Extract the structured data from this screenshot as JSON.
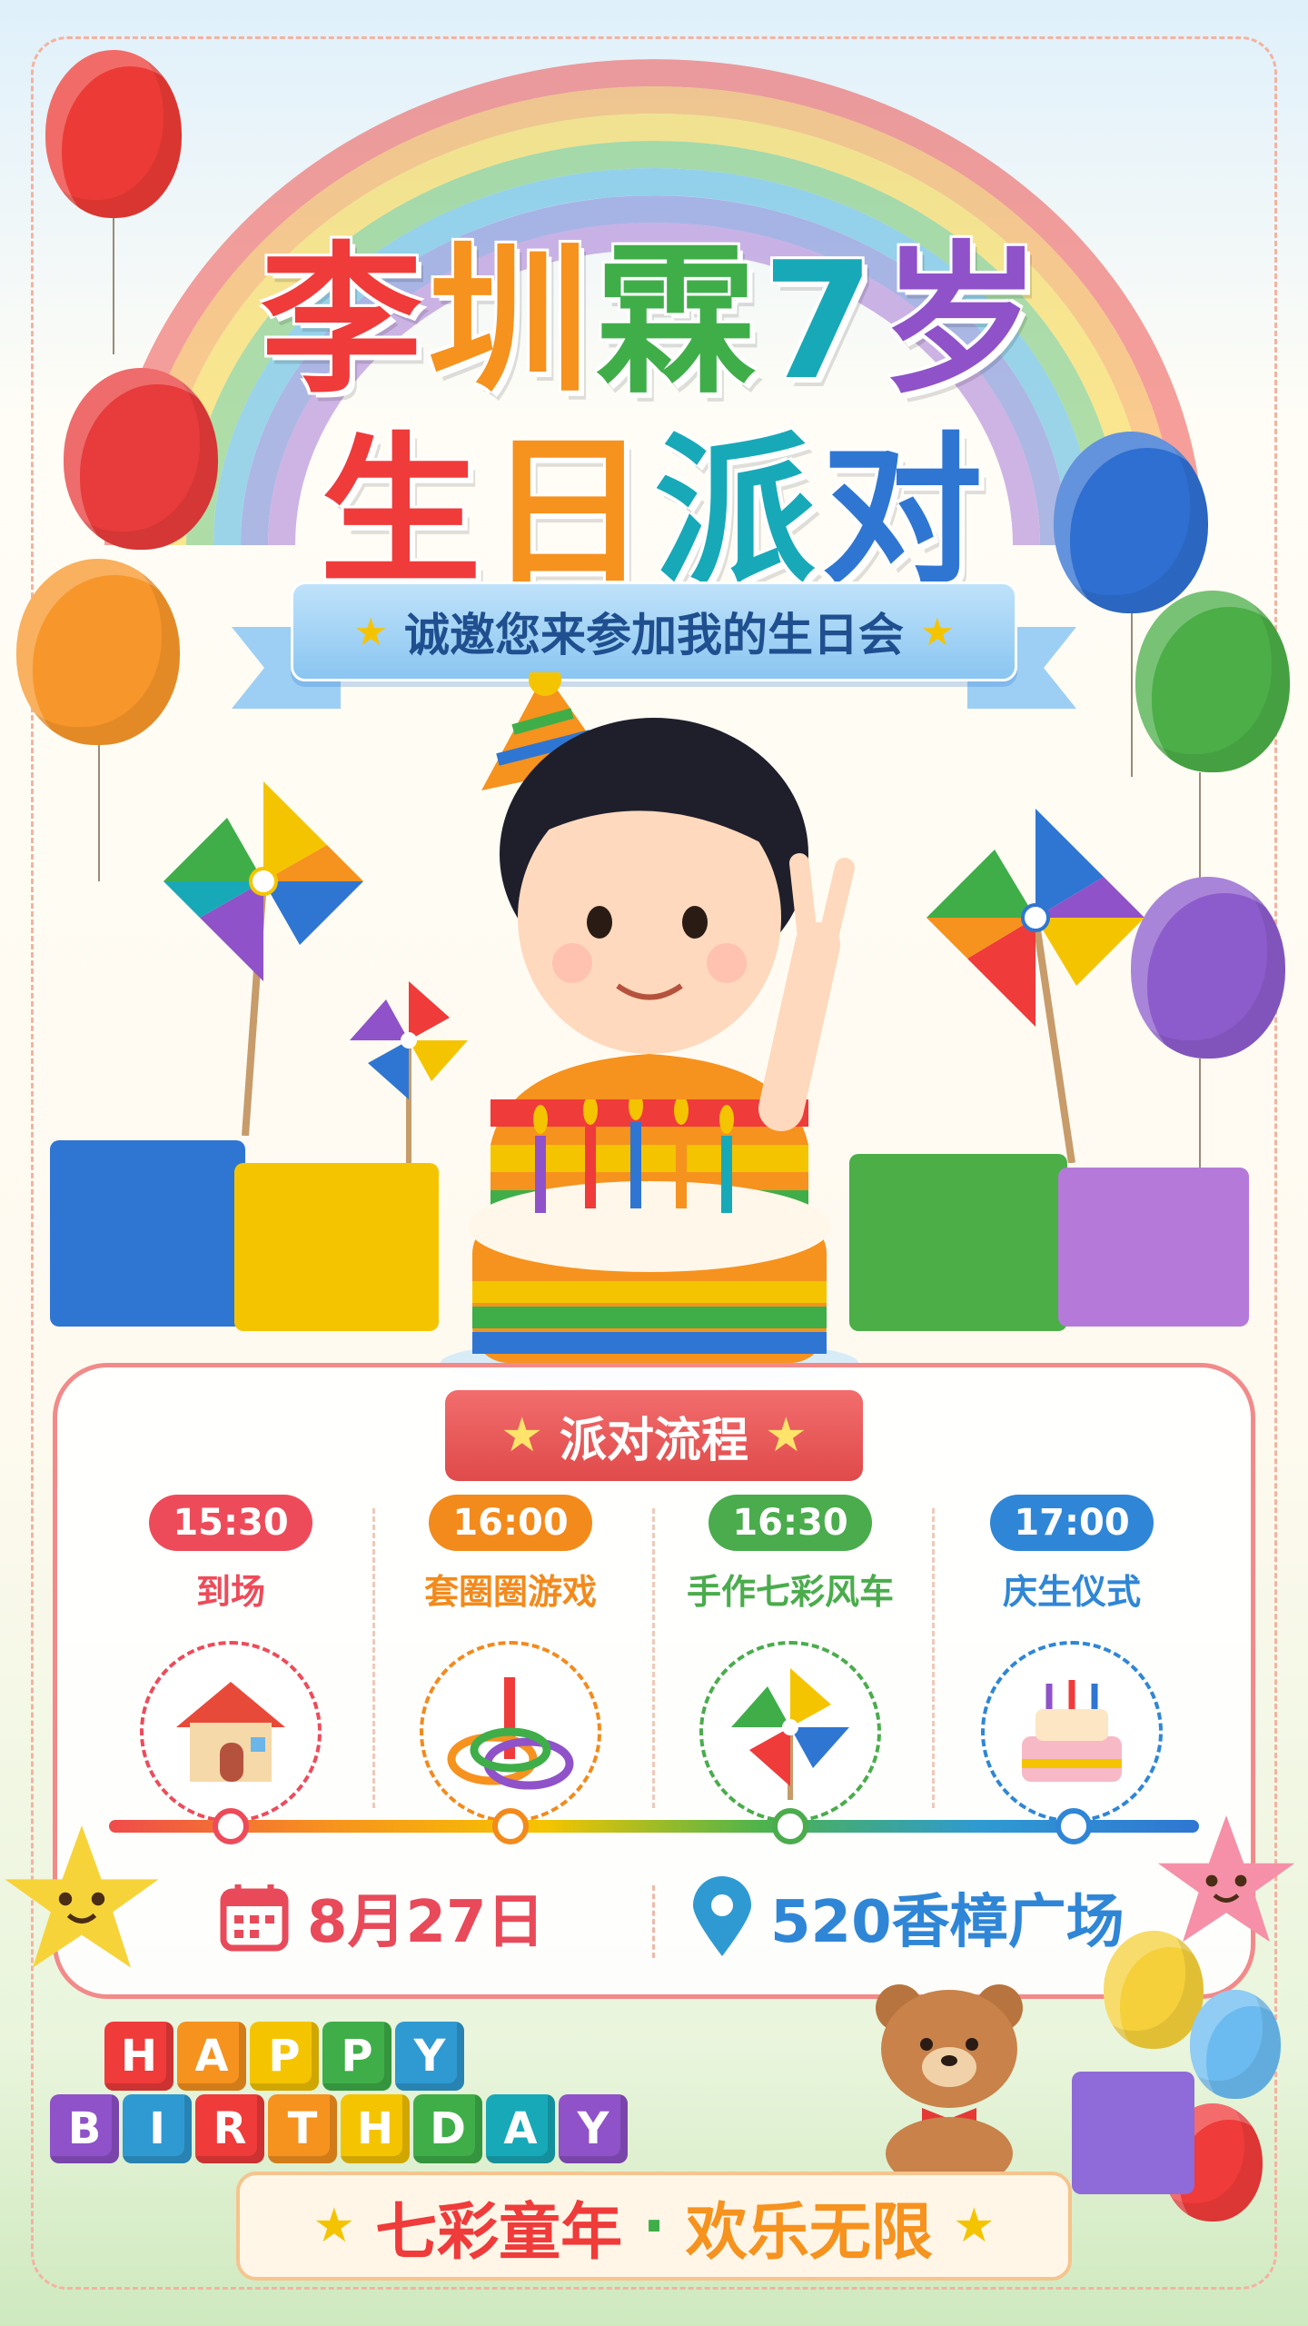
{
  "title": {
    "line1": [
      {
        "text": "李",
        "color": "red"
      },
      {
        "text": "圳",
        "color": "orange"
      },
      {
        "text": "霖",
        "color": "green"
      },
      {
        "text": "7",
        "color": "teal"
      },
      {
        "text": "岁",
        "color": "purple"
      }
    ],
    "line2": [
      {
        "text": "生",
        "color": "red"
      },
      {
        "text": "日",
        "color": "orange"
      },
      {
        "text": "派",
        "color": "teal"
      },
      {
        "text": "对",
        "color": "blue"
      }
    ]
  },
  "invite": "诚邀您来参加我的生日会",
  "schedule": {
    "heading": "派对流程",
    "items": [
      {
        "time": "15:30",
        "activity": "到场",
        "color": "#ee4b5a",
        "icon": "house-icon"
      },
      {
        "time": "16:00",
        "activity": "套圈圈游戏",
        "color": "#f38a1c",
        "icon": "ring-toss-icon"
      },
      {
        "time": "16:30",
        "activity": "手作七彩风车",
        "color": "#4aac4c",
        "icon": "pinwheel-icon"
      },
      {
        "time": "17:00",
        "activity": "庆生仪式",
        "color": "#2f86d6",
        "icon": "cake-icon"
      }
    ]
  },
  "date": "8月27日",
  "location": "520香樟广场",
  "blocks": {
    "row1": [
      "H",
      "A",
      "P",
      "P",
      "Y"
    ],
    "row2": [
      "B",
      "I",
      "R",
      "T",
      "H",
      "D",
      "A",
      "Y"
    ]
  },
  "slogan": {
    "part1": "七彩童年",
    "dot": "·",
    "part2": "欢乐无限"
  },
  "colors": {
    "red": "#ef3b3a",
    "orange": "#f6921e",
    "green": "#3fae49",
    "teal": "#18a9b8",
    "blue": "#2f76d2",
    "purple": "#8f52c9"
  }
}
